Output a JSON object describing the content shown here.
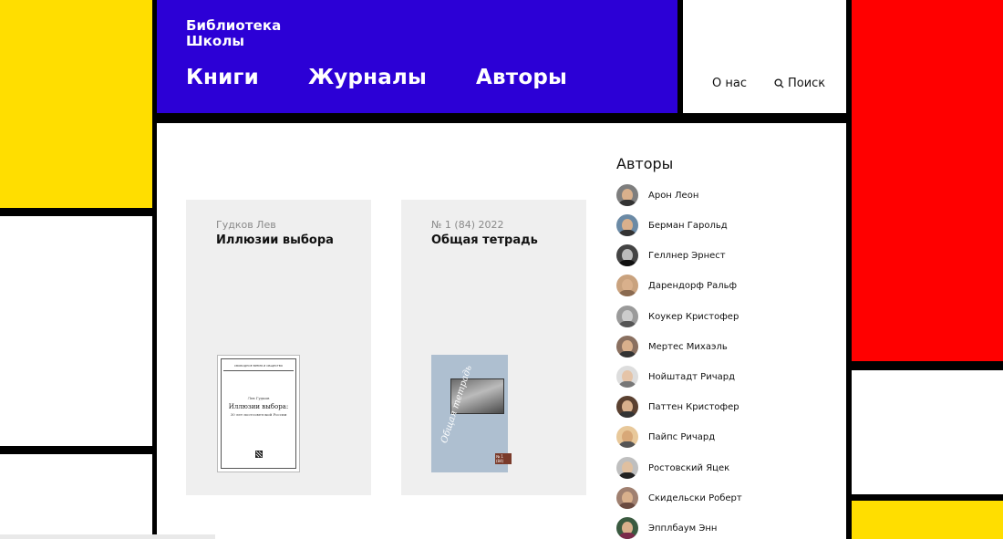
{
  "site": {
    "brand_line1": "Библиотека",
    "brand_line2": "Школы"
  },
  "nav_main": {
    "books": "Книги",
    "journals": "Журналы",
    "authors": "Авторы"
  },
  "nav_side": {
    "about": "О нас",
    "search": "Поиск"
  },
  "cards": [
    {
      "subtitle": "Гудков Лев",
      "title": "Иллюзии выбора",
      "cover": {
        "top_text": "СВОБОДНОЕ ВРЕМЯ И ОБЩЕСТВО",
        "author": "Лев Гудков",
        "title": "Иллюзии выбора:",
        "subtitle": "30 лет постсоветской России"
      }
    },
    {
      "subtitle": "№ 1 (84) 2022",
      "title": "Общая тетрадь",
      "cover": {
        "script_title": "Общая тетрадь",
        "issue": "№ 1 (84)"
      }
    }
  ],
  "authors": {
    "title": "Авторы",
    "items": [
      {
        "name": "Арон Леон"
      },
      {
        "name": "Берман Гарольд"
      },
      {
        "name": "Геллнер Эрнест"
      },
      {
        "name": "Дарендорф Ральф"
      },
      {
        "name": "Коукер Кристофер"
      },
      {
        "name": "Мертес Михаэль"
      },
      {
        "name": "Нойштадт Ричард"
      },
      {
        "name": "Паттен Кристофер"
      },
      {
        "name": "Пайпс Ричард"
      },
      {
        "name": "Ростовский Яцек"
      },
      {
        "name": "Скидельски Роберт"
      },
      {
        "name": "Эпплбаум Энн"
      }
    ]
  },
  "colors": {
    "yellow": "#ffde00",
    "red": "#ff0000",
    "blue": "#2c00d6",
    "white": "#ffffff",
    "grid": "#000000"
  }
}
